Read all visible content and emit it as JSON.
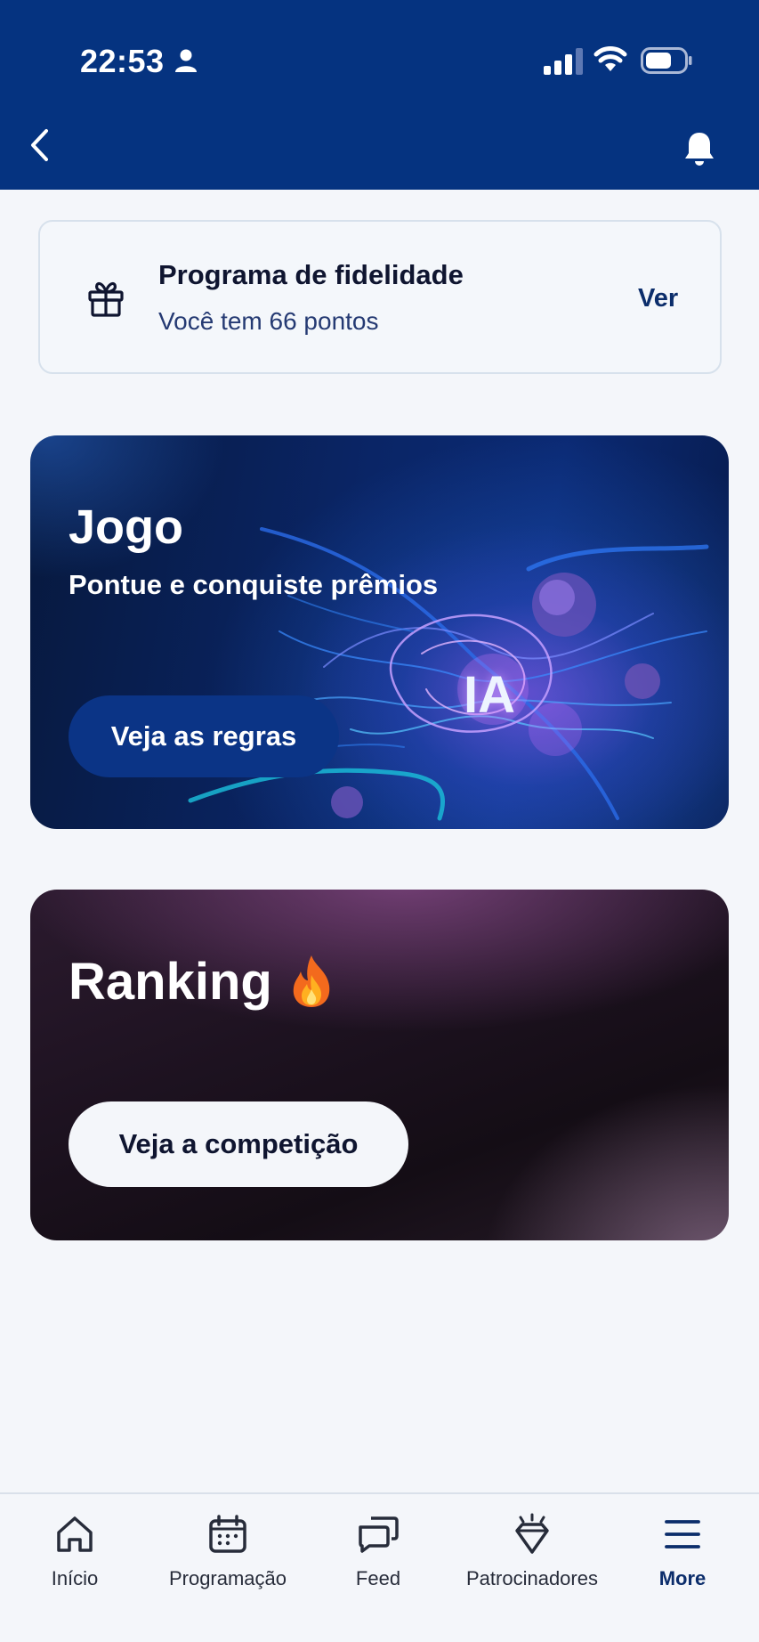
{
  "status_bar": {
    "time": "22:53"
  },
  "loyalty": {
    "title": "Programa de fidelidade",
    "subtitle": "Você tem 66 pontos",
    "action_label": "Ver"
  },
  "game_card": {
    "title": "Jogo",
    "subtitle": "Pontue e conquiste prêmios",
    "art_text": "IA",
    "button_label": "Veja as regras"
  },
  "ranking_card": {
    "title": "Ranking",
    "button_label": "Veja a competição"
  },
  "bottom_nav": {
    "items": [
      {
        "label": "Início",
        "icon": "home-icon"
      },
      {
        "label": "Programação",
        "icon": "calendar-icon"
      },
      {
        "label": "Feed",
        "icon": "chat-bubbles-icon"
      },
      {
        "label": "Patrocinadores",
        "icon": "diamond-icon"
      },
      {
        "label": "More",
        "icon": "menu-icon"
      }
    ],
    "active_index": 4
  },
  "colors": {
    "header": "#053380",
    "accent": "#0b2d6b",
    "background": "#f4f6fa"
  }
}
